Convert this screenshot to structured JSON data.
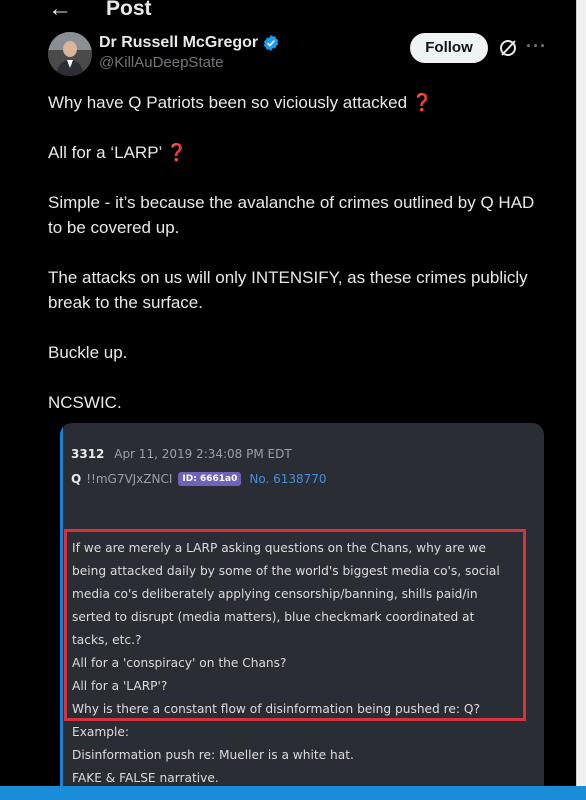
{
  "header": {
    "title": "Post"
  },
  "author": {
    "name": "Dr Russell McGregor",
    "handle": "@KillAuDeepState",
    "follow_label": "Follow"
  },
  "post": {
    "line1": "Why have Q Patriots been so viciously attacked",
    "line2": "All for a ‘LARP’",
    "line3": "Simple - it’s because the avalanche of crimes outlined by Q HAD to be covered up.",
    "line4": "The attacks on us will only INTENSIFY, as these crimes publicly break to the surface.",
    "line5": "Buckle up.",
    "line6": "NCSWIC."
  },
  "embed": {
    "post_number": "3312",
    "timestamp": "Apr 11, 2019 2:34:08 PM EDT",
    "author": "Q",
    "tripcode": "!!mG7VJxZNCI",
    "id_badge": "ID: 6661a0",
    "no_label": "No. 6138770",
    "quote_lines": [
      "If we are merely a LARP asking questions on the Chans, why are we",
      "being attacked daily by some of the world's biggest media co's, social",
      "media co's deliberately applying censorship/banning, shills paid/in",
      "serted to disrupt (media matters), blue checkmark coordinated at",
      "tacks, etc.?",
      "All for a 'conspiracy' on the Chans?",
      "All for a 'LARP'?",
      "Why is there a constant flow of disinformation being pushed re: Q?",
      "Example:",
      "Disinformation push re: Mueller is a white hat.",
      "FAKE & FALSE narrative."
    ]
  },
  "colors": {
    "background": "#000000",
    "text": "#e7e9ea",
    "secondary_text": "#71767b",
    "verified_blue": "#1d9bf0",
    "question_mark_red": "#e0245e",
    "highlight_border": "#d4333b",
    "embed_background": "#2a2d33"
  },
  "icons": [
    "back-arrow-icon",
    "verified-badge-icon",
    "grok-icon",
    "more-options-icon",
    "red-question-mark-icon"
  ]
}
